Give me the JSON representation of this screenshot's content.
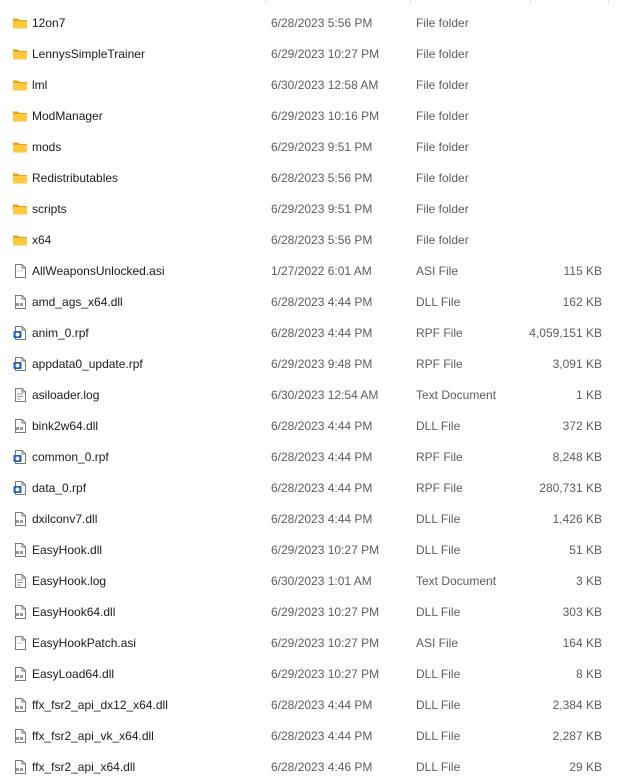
{
  "colors": {
    "folder_back": "#e8a317",
    "folder_front": "#ffc83d",
    "doc_border": "#7a7a7a",
    "rpf_blue": "#1d5fbf"
  },
  "files": [
    {
      "name": "12on7",
      "date": "6/28/2023 5:56 PM",
      "type": "File folder",
      "size": "",
      "icon": "folder-icon"
    },
    {
      "name": "LennysSimpleTrainer",
      "date": "6/29/2023 10:27 PM",
      "type": "File folder",
      "size": "",
      "icon": "folder-icon"
    },
    {
      "name": "lml",
      "date": "6/30/2023 12:58 AM",
      "type": "File folder",
      "size": "",
      "icon": "folder-icon"
    },
    {
      "name": "ModManager",
      "date": "6/29/2023 10:16 PM",
      "type": "File folder",
      "size": "",
      "icon": "folder-icon"
    },
    {
      "name": "mods",
      "date": "6/29/2023 9:51 PM",
      "type": "File folder",
      "size": "",
      "icon": "folder-icon"
    },
    {
      "name": "Redistributables",
      "date": "6/28/2023 5:56 PM",
      "type": "File folder",
      "size": "",
      "icon": "folder-icon"
    },
    {
      "name": "scripts",
      "date": "6/29/2023 9:51 PM",
      "type": "File folder",
      "size": "",
      "icon": "folder-icon"
    },
    {
      "name": "x64",
      "date": "6/28/2023 5:56 PM",
      "type": "File folder",
      "size": "",
      "icon": "folder-icon"
    },
    {
      "name": "AllWeaponsUnlocked.asi",
      "date": "1/27/2022 6:01 AM",
      "type": "ASI File",
      "size": "115 KB",
      "icon": "file-icon"
    },
    {
      "name": "amd_ags_x64.dll",
      "date": "6/28/2023 4:44 PM",
      "type": "DLL File",
      "size": "162 KB",
      "icon": "dll-file-icon"
    },
    {
      "name": "anim_0.rpf",
      "date": "6/28/2023 4:44 PM",
      "type": "RPF File",
      "size": "4,059,151 KB",
      "icon": "rpf-file-icon"
    },
    {
      "name": "appdata0_update.rpf",
      "date": "6/29/2023 9:48 PM",
      "type": "RPF File",
      "size": "3,091 KB",
      "icon": "rpf-file-icon"
    },
    {
      "name": "asiloader.log",
      "date": "6/30/2023 12:54 AM",
      "type": "Text Document",
      "size": "1 KB",
      "icon": "text-file-icon"
    },
    {
      "name": "bink2w64.dll",
      "date": "6/28/2023 4:44 PM",
      "type": "DLL File",
      "size": "372 KB",
      "icon": "dll-file-icon"
    },
    {
      "name": "common_0.rpf",
      "date": "6/28/2023 4:44 PM",
      "type": "RPF File",
      "size": "8,248 KB",
      "icon": "rpf-file-icon"
    },
    {
      "name": "data_0.rpf",
      "date": "6/28/2023 4:44 PM",
      "type": "RPF File",
      "size": "280,731 KB",
      "icon": "rpf-file-icon"
    },
    {
      "name": "dxilconv7.dll",
      "date": "6/28/2023 4:44 PM",
      "type": "DLL File",
      "size": "1,426 KB",
      "icon": "dll-file-icon"
    },
    {
      "name": "EasyHook.dll",
      "date": "6/29/2023 10:27 PM",
      "type": "DLL File",
      "size": "51 KB",
      "icon": "dll-file-icon"
    },
    {
      "name": "EasyHook.log",
      "date": "6/30/2023 1:01 AM",
      "type": "Text Document",
      "size": "3 KB",
      "icon": "text-file-icon"
    },
    {
      "name": "EasyHook64.dll",
      "date": "6/29/2023 10:27 PM",
      "type": "DLL File",
      "size": "303 KB",
      "icon": "dll-file-icon"
    },
    {
      "name": "EasyHookPatch.asi",
      "date": "6/29/2023 10:27 PM",
      "type": "ASI File",
      "size": "164 KB",
      "icon": "file-icon"
    },
    {
      "name": "EasyLoad64.dll",
      "date": "6/29/2023 10:27 PM",
      "type": "DLL File",
      "size": "8 KB",
      "icon": "dll-file-icon"
    },
    {
      "name": "ffx_fsr2_api_dx12_x64.dll",
      "date": "6/28/2023 4:44 PM",
      "type": "DLL File",
      "size": "2,384 KB",
      "icon": "dll-file-icon"
    },
    {
      "name": "ffx_fsr2_api_vk_x64.dll",
      "date": "6/28/2023 4:44 PM",
      "type": "DLL File",
      "size": "2,287 KB",
      "icon": "dll-file-icon"
    },
    {
      "name": "ffx_fsr2_api_x64.dll",
      "date": "6/28/2023 4:46 PM",
      "type": "DLL File",
      "size": "29 KB",
      "icon": "dll-file-icon"
    }
  ]
}
